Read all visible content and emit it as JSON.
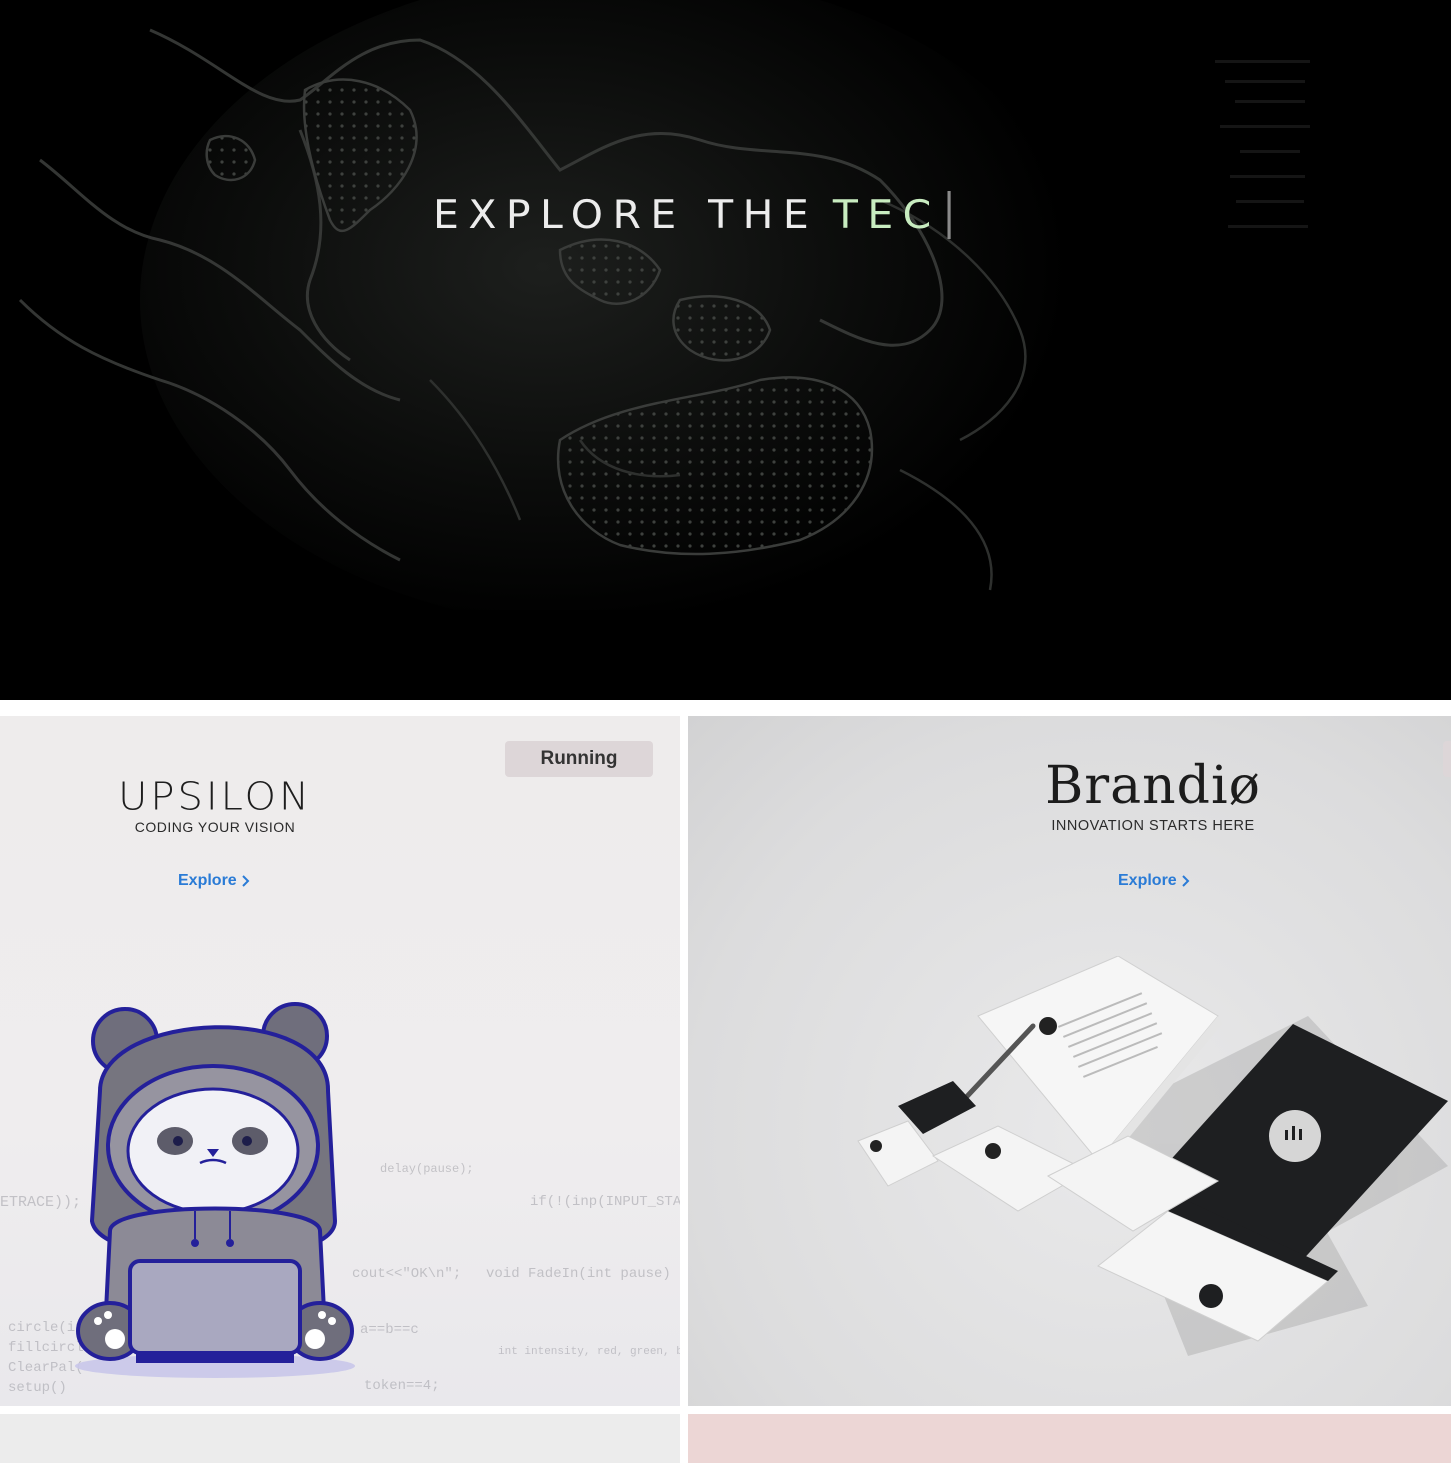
{
  "hero": {
    "title_main": "EXPLORE THE",
    "title_accent": "TEC",
    "accent_color": "#c8ecc0",
    "background": "dark world map"
  },
  "cards": [
    {
      "brand": "UPSILON",
      "tagline": "CODING YOUR  VISION",
      "link_label": "Explore",
      "status_badge": "Running",
      "illustration": "panda-hoodie-laptop",
      "code_lines": [
        "cout<<\"OK\\n\";",
        "void FadeIn(int pause)",
        "ETRACE));",
        "circle(int x,",
        "fillcircle(int",
        "ClearPal(",
        "setup()",
        "token==4;",
        "a==b==c",
        "if(!(inp(INPUT_STATUS) &",
        "int intensity, red, green, blue;",
        "delay(pause);"
      ]
    },
    {
      "brand": "Brandiø",
      "tagline": "INNOVATION STARTS HERE",
      "link_label": "Explore",
      "illustration": "stationery-mockup"
    }
  ],
  "colors": {
    "link": "#2a7bd6",
    "badge_bg": "#ddd6d8",
    "bottom_left_bg": "#ececec",
    "bottom_right_bg": "#ecd6d5"
  }
}
